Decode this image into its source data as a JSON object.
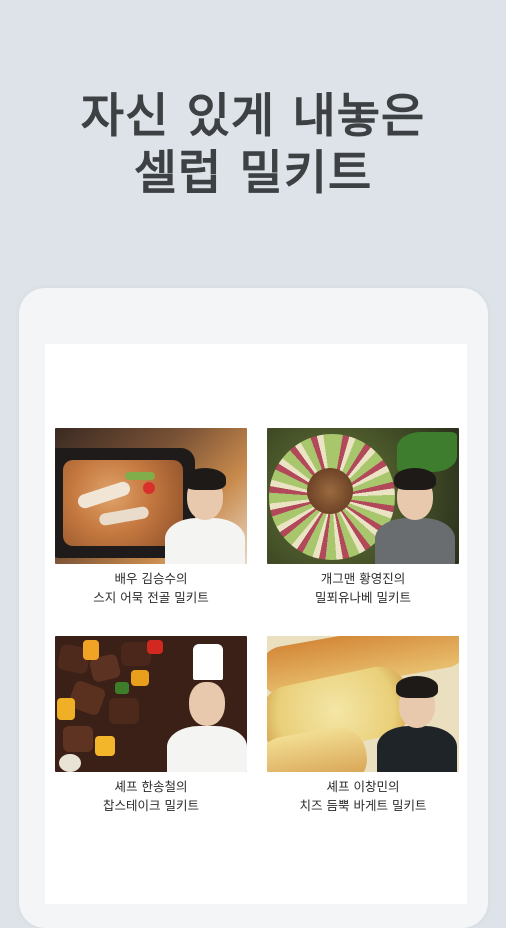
{
  "headline": {
    "line1": "자신 있게 내놓은",
    "line2": "셀럽 밀키트"
  },
  "products": [
    {
      "line1": "배우 김승수의",
      "line2": "스지 어묵 전골 밀키트",
      "image_icon": "hotpot-photo"
    },
    {
      "line1": "개그맨 황영진의",
      "line2": "밀푀유나베 밀키트",
      "image_icon": "millefeuille-nabe-photo"
    },
    {
      "line1": "셰프 한송철의",
      "line2": "찹스테이크 밀키트",
      "image_icon": "chop-steak-photo"
    },
    {
      "line1": "셰프 이창민의",
      "line2": "치즈 듬뿍 바게트 밀키트",
      "image_icon": "cheese-baguette-photo"
    }
  ],
  "colors": {
    "background": "#dde3e8",
    "headline_text": "#3e4144",
    "device_frame": "#f3f5f7",
    "screen": "#ffffff"
  }
}
